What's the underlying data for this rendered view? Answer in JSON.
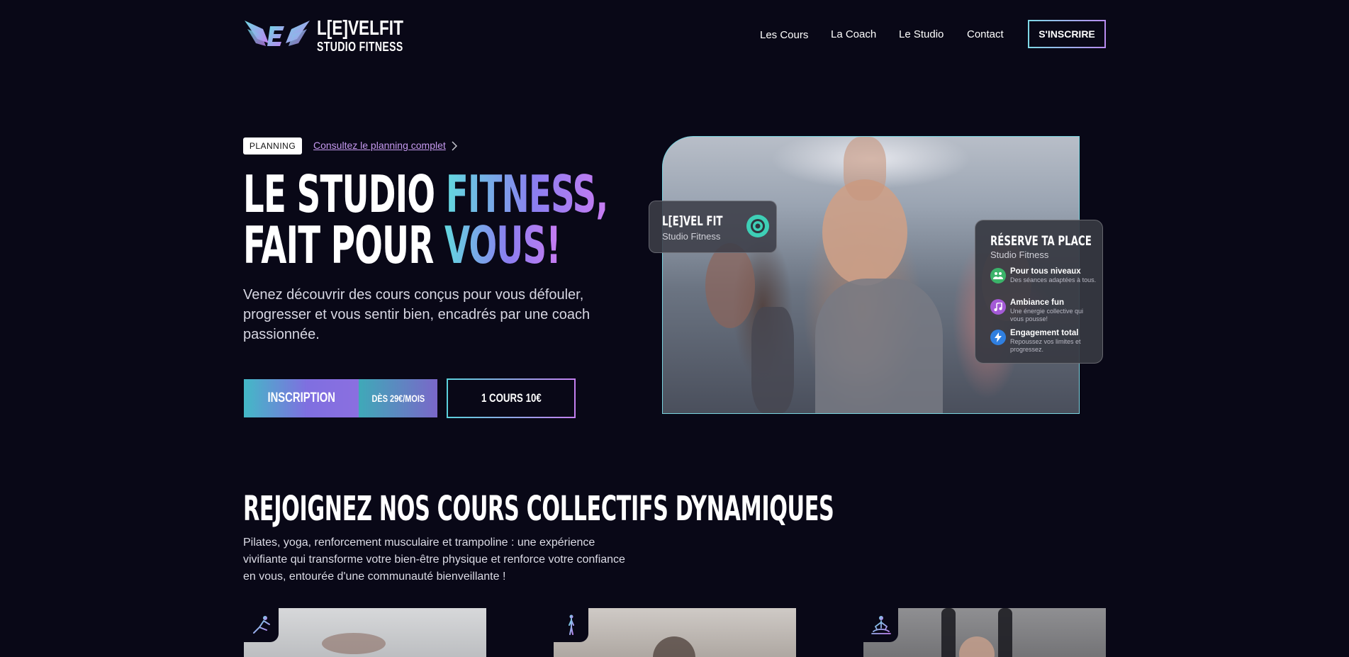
{
  "header": {
    "logo": {
      "title": "L[E]VELFIT",
      "subtitle": "STUDIO FITNESS"
    },
    "nav": [
      {
        "label": "Les Cours"
      },
      {
        "label": "La Coach"
      },
      {
        "label": "Le Studio"
      },
      {
        "label": "Contact"
      }
    ],
    "signup_label": "S'INSCRIRE"
  },
  "hero": {
    "tag": "PLANNING",
    "planning_link": "Consultez le planning complet",
    "title_line1_a": "LE STUDIO ",
    "title_line1_b": "FITNESS,",
    "title_line2_a": "FAIT POUR ",
    "title_line2_b": "VOUS!",
    "description": "Venez découvrir des cours conçus pour vous défouler, progresser et vous sentir bien, encadrés par une coach passionnée.",
    "cta_main": "INSCRIPTION",
    "cta_price": "DÈS 29€/MOIS",
    "cta_single": "1 COURS 10€"
  },
  "cards": {
    "brand": {
      "title": "L[E]VEL FIT",
      "subtitle": "Studio Fitness"
    },
    "reserve": {
      "title": "RÉSERVE TA PLACE",
      "subtitle": "Studio Fitness",
      "features": [
        {
          "title": "Pour tous niveaux",
          "desc": "Des séances adaptées à tous.",
          "icon": "people-icon",
          "color": "#3bb36a"
        },
        {
          "title": "Ambiance fun",
          "desc": "Une énergie collective qui vous pousse!",
          "icon": "music-icon",
          "color": "#a45ad6"
        },
        {
          "title": "Engagement total",
          "desc": "Repoussez vos limites et progressez.",
          "icon": "lightning-icon",
          "color": "#2f7fe0"
        }
      ]
    }
  },
  "section": {
    "title": "REJOIGNEZ NOS COURS COLLECTIFS DYNAMIQUES",
    "description": "Pilates, yoga, renforcement musculaire et trampoline : une expérience vivifiante qui transforme votre bien-être physique et renforce votre confiance en vous, entourée d'une communauté bienveillante !"
  },
  "colors": {
    "background": "#090817",
    "accent_teal": "#5bd1dc",
    "accent_purple": "#c37ff0"
  }
}
